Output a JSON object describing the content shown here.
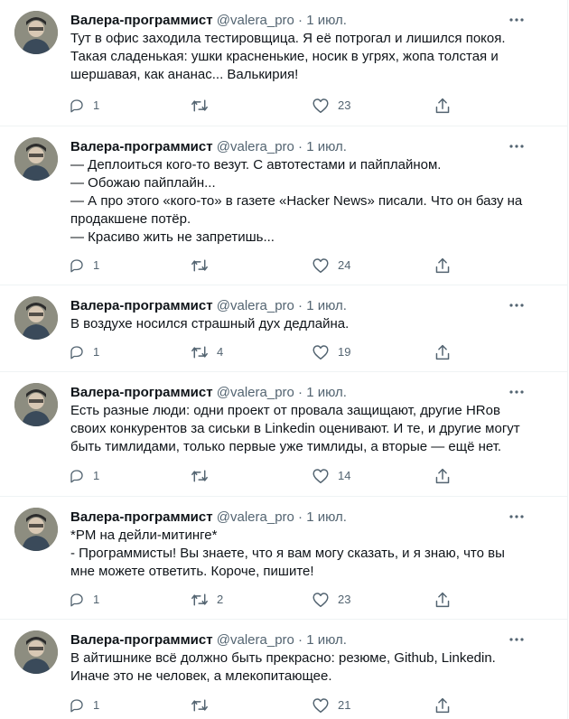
{
  "tweets": [
    {
      "name": "Валера-программист",
      "handle": "@valera_pro",
      "separator": "·",
      "date": "1 июл.",
      "text": "Тут в офис заходила тестировщица. Я её потрогал и лишился покоя.\nТакая сладенькая: ушки красненькие, носик в угрях, жопа толстая и\nшершавая, как ананас... Валькирия!",
      "replies": "1",
      "retweets": "",
      "likes": "23"
    },
    {
      "name": "Валера-программист",
      "handle": "@valera_pro",
      "separator": "·",
      "date": "1 июл.",
      "text": "— Деплоиться кого-то везут. С автотестами и пайплайном.\n— Обожаю пайплайн...\n— А про этого «кого-то» в газете «Hacker News» писали. Что он базу на\nпродакшене потёр.\n— Красиво жить не запретишь...",
      "replies": "1",
      "retweets": "",
      "likes": "24"
    },
    {
      "name": "Валера-программист",
      "handle": "@valera_pro",
      "separator": "·",
      "date": "1 июл.",
      "text": "В воздухе носился страшный дух дедлайна.",
      "replies": "1",
      "retweets": "4",
      "likes": "19"
    },
    {
      "name": "Валера-программист",
      "handle": "@valera_pro",
      "separator": "·",
      "date": "1 июл.",
      "text": "Есть разные люди: одни проект от провала защищают, другие HRов\nсвоих конкурентов за сиськи в Linkedin оценивают. И те, и другие могут\nбыть тимлидами, только первые уже тимлиды, а вторые — ещё нет.",
      "replies": "1",
      "retweets": "",
      "likes": "14"
    },
    {
      "name": "Валера-программист",
      "handle": "@valera_pro",
      "separator": "·",
      "date": "1 июл.",
      "text": "*PM на дейли-митинге*\n- Программисты! Вы знаете, что я вам могу сказать, и я знаю, что вы\nмне можете ответить. Короче, пишите!",
      "replies": "1",
      "retweets": "2",
      "likes": "23"
    },
    {
      "name": "Валера-программист",
      "handle": "@valera_pro",
      "separator": "·",
      "date": "1 июл.",
      "text": "В айтишнике всё должно быть прекрасно: резюме, Github, Linkedin.\nИначе это не человек, а млекопитающее.",
      "replies": "1",
      "retweets": "",
      "likes": "21"
    }
  ],
  "icons": {
    "reply": "reply-icon",
    "retweet": "retweet-icon",
    "like": "heart-icon",
    "share": "share-icon",
    "more": "more-icon"
  },
  "colors": {
    "text": "#0f1419",
    "secondary": "#536471",
    "divider": "#eff3f4"
  }
}
